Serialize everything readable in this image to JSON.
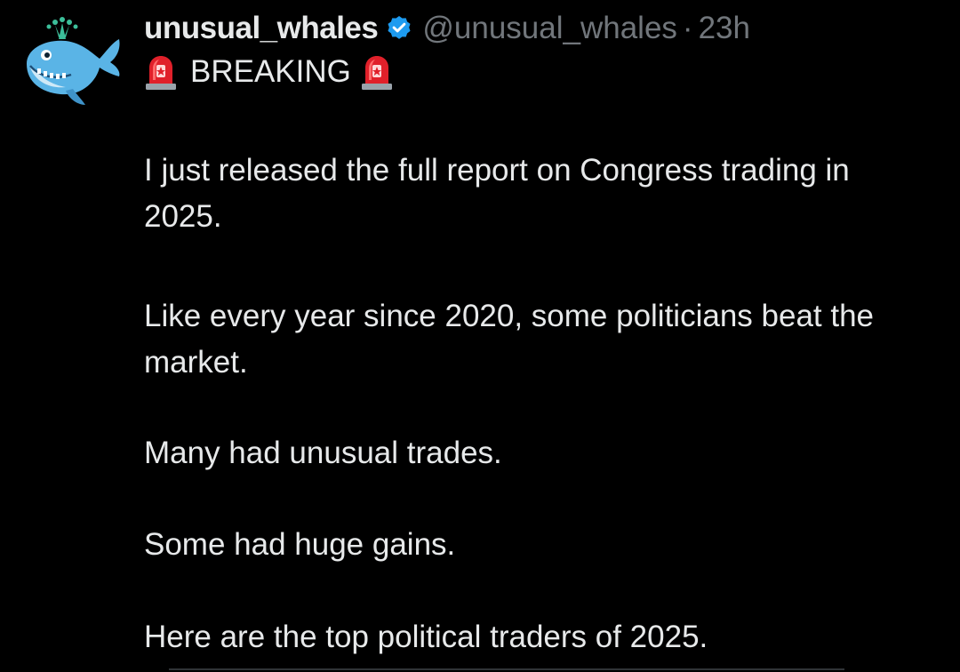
{
  "tweet": {
    "author": {
      "display_name": "unusual_whales",
      "handle": "@unusual_whales",
      "verified": true,
      "avatar_icon": "whale-avatar-icon"
    },
    "separator": "·",
    "time": "23h",
    "breaking": {
      "label": "BREAKING",
      "icon": "police-siren-icon"
    },
    "paragraphs": [
      "I just released the full report on Congress trading in 2025.",
      "Like every year since 2020, some politicians beat the market.",
      "Many had unusual trades.",
      "Some had huge gains.",
      "Here are the top political traders of 2025."
    ]
  },
  "colors": {
    "background": "#000000",
    "primary_text": "#e7e9ea",
    "secondary_text": "#71767b",
    "verified_blue": "#1d9bf0",
    "siren_red": "#e0202a",
    "whale_blue": "#5ab4e6",
    "spout_green": "#3cbf9a"
  }
}
